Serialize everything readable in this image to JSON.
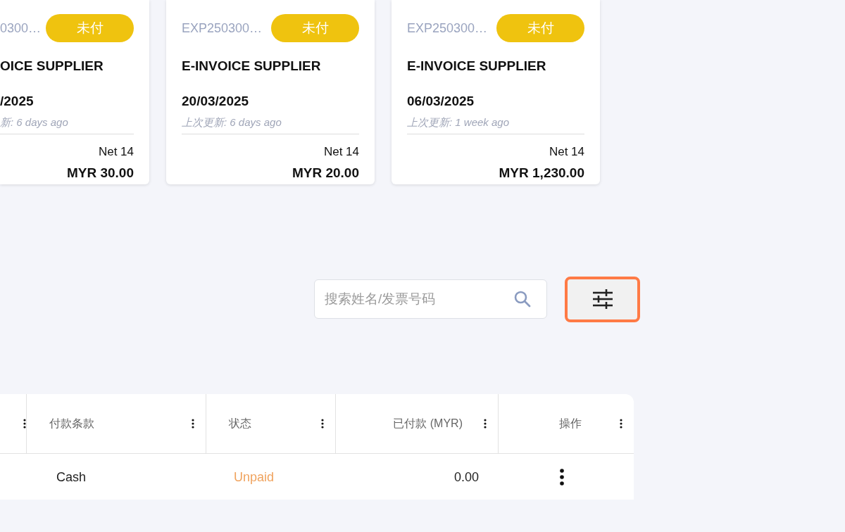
{
  "cards": [
    {
      "invoice_no": "0300…",
      "status": "未付",
      "color": "#efc30f",
      "supplier": "OICE SUPPLIER",
      "date": "/2025",
      "updated": "新: 6 days ago",
      "terms": "Net 14",
      "amount": "MYR 30.00",
      "cut": true
    },
    {
      "invoice_no": "EXP250300…",
      "status": "未付",
      "color": "#efc30f",
      "supplier": "E-INVOICE SUPPLIER",
      "date": "20/03/2025",
      "updated": "上次更新: 6 days ago",
      "terms": "Net 14",
      "amount": "MYR 20.00",
      "cut": false
    },
    {
      "invoice_no": "EXP250300…",
      "status": "未付",
      "color": "#efc30f",
      "supplier": "E-INVOICE SUPPLIER",
      "date": "06/03/2025",
      "updated": "上次更新: 1 week ago",
      "terms": "Net 14",
      "amount": "MYR 1,230.00",
      "cut": false
    }
  ],
  "search": {
    "placeholder": "搜索姓名/发票号码"
  },
  "filter_button": {
    "highlighted": true
  },
  "table": {
    "columns": [
      {},
      {
        "label": "付款条款"
      },
      {
        "label": "状态"
      },
      {
        "label": "已付款 (MYR)"
      },
      {
        "label": "操作"
      }
    ],
    "rows": [
      {
        "cells": [
          {
            "kind": "empty"
          },
          {
            "kind": "text",
            "text": "Cash"
          },
          {
            "kind": "status",
            "text": "Unpaid",
            "color": "#f0a35e"
          },
          {
            "kind": "number",
            "text": "0.00"
          },
          {
            "kind": "menu"
          }
        ]
      }
    ]
  }
}
